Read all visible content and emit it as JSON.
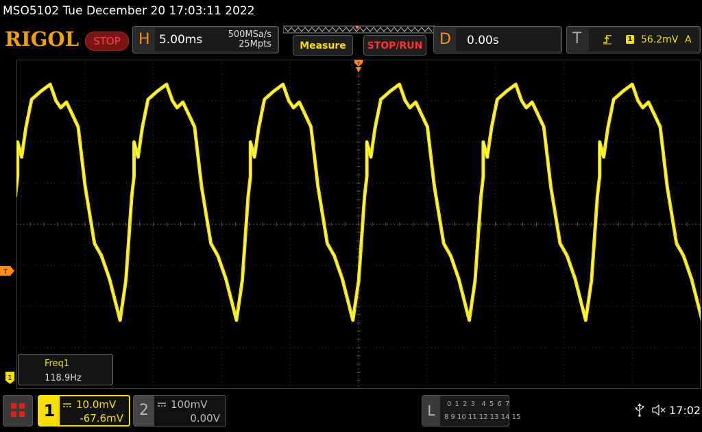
{
  "title_bar": {
    "text": "MSO5102  Tue December 20 17:03:11 2022"
  },
  "toolbar": {
    "logo": "RIGOL",
    "run_state": "STOP",
    "horizontal": {
      "letter": "H",
      "timebase": "5.00ms",
      "sample_rate": "500MSa/s",
      "memory_depth": "25Mpts"
    },
    "measure_button": "Measure",
    "stoprun_button": "STOP/RUN",
    "delay": {
      "letter": "D",
      "value": "0.00s"
    },
    "trigger": {
      "letter": "T",
      "source": "1",
      "level": "56.2mV",
      "mode": "A"
    }
  },
  "measurement": {
    "name": "Freq1",
    "value": "118.9Hz"
  },
  "channel1": {
    "number": "1",
    "scale": "10.0mV",
    "offset": "-67.6mV"
  },
  "channel2": {
    "number": "2",
    "scale": "100mV",
    "offset": "0.00V"
  },
  "logic": {
    "letter": "L",
    "row1": "0 1 2 3  4 5 6 7",
    "row2": "8 9 10 11 12 13 14 15"
  },
  "status": {
    "time": "17:02"
  },
  "colors": {
    "trace": "#f5e000",
    "accent": "#ff8c1a",
    "stop": "#ff3030"
  },
  "icons": {
    "menu": "grid-menu-icon",
    "usb": "usb-icon",
    "sound": "speaker-muted-icon",
    "trigger_slope": "rising-edge-icon"
  }
}
